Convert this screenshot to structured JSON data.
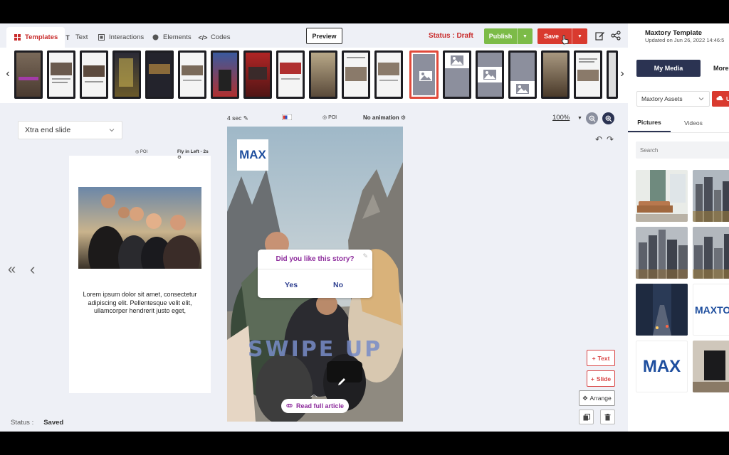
{
  "tabs": [
    {
      "label": "Templates"
    },
    {
      "label": "Text"
    },
    {
      "label": "Interactions"
    },
    {
      "label": "Elements"
    },
    {
      "label": "Codes"
    }
  ],
  "toolbar": {
    "preview": "Preview",
    "status": "Status : Draft",
    "publish": "Publish",
    "save": "Save"
  },
  "editor": {
    "end_slide_select": "Xtra end slide",
    "duration": "4 sec",
    "poi": "POI",
    "animation": "No animation",
    "zoom": "100%"
  },
  "prev_slide": {
    "poi": "POI",
    "animation": "Fly in Left - 2s",
    "body": "Lorem ipsum dolor sit amet, consectetur adipiscing elit. Pellentesque velit elit, ullamcorper hendrerit justo eget,"
  },
  "story": {
    "logo": "MAX",
    "poll_question": "Did you like this story?",
    "poll_yes": "Yes",
    "poll_no": "No",
    "swipe_text": "SWIPE UP",
    "cta": "Read full article"
  },
  "side_actions": {
    "text": "Text",
    "slide": "Slide",
    "arrange": "Arrange"
  },
  "footer": {
    "status_label": "Status :",
    "status_value": "Saved"
  },
  "right_panel": {
    "title": "Maxtory Template",
    "updated": "Updated on Jun 26, 2022 14:46:5",
    "tab_my_media": "My Media",
    "tab_more": "More me",
    "assets": "Maxtory Assets",
    "upload": "U",
    "tab_pictures": "Pictures",
    "tab_videos": "Videos",
    "search_placeholder": "Search",
    "tile_maxto": "MAXTO",
    "tile_max": "MAX"
  },
  "colors": {
    "brand_red": "#d93a2f",
    "publish_green": "#7cbb48",
    "navy": "#2b3352",
    "poll_purple": "#8d2b9c"
  }
}
